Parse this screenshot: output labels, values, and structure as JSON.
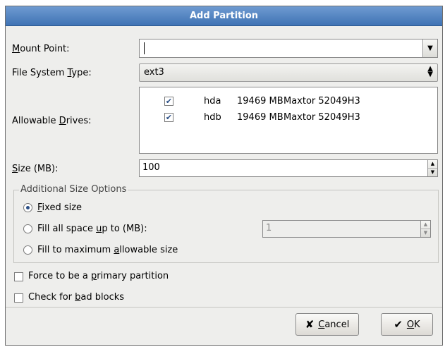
{
  "dialog": {
    "title": "Add Partition"
  },
  "mount_point": {
    "label_pre": "",
    "label_u": "M",
    "label_post": "ount Point:",
    "value": ""
  },
  "fs_type": {
    "label_pre": "File System ",
    "label_u": "T",
    "label_post": "ype:",
    "value": "ext3"
  },
  "drives": {
    "label_pre": "Allowable ",
    "label_u": "D",
    "label_post": "rives:",
    "rows": [
      {
        "checked": "✔",
        "name": "hda",
        "size": "19469 MB",
        "model": "Maxtor 52049H3"
      },
      {
        "checked": "✔",
        "name": "hdb",
        "size": "19469 MB",
        "model": "Maxtor 52049H3"
      }
    ]
  },
  "size": {
    "label_pre": "",
    "label_u": "S",
    "label_post": "ize (MB):",
    "value": "100"
  },
  "size_options": {
    "title": "Additional Size Options",
    "fixed": {
      "pre": "",
      "u": "F",
      "post": "ixed size"
    },
    "fill_upto": {
      "pre": "Fill all space ",
      "u": "u",
      "post": "p to (MB):",
      "value": "1"
    },
    "fill_max": {
      "pre": "Fill to maximum ",
      "u": "a",
      "post": "llowable size"
    }
  },
  "primary": {
    "pre": "Force to be a ",
    "u": "p",
    "post": "rimary partition"
  },
  "badblocks": {
    "pre": "Check for ",
    "u": "b",
    "post": "ad blocks"
  },
  "buttons": {
    "cancel": {
      "u": "C",
      "post": "ancel"
    },
    "ok": {
      "u": "O",
      "post": "K"
    }
  }
}
